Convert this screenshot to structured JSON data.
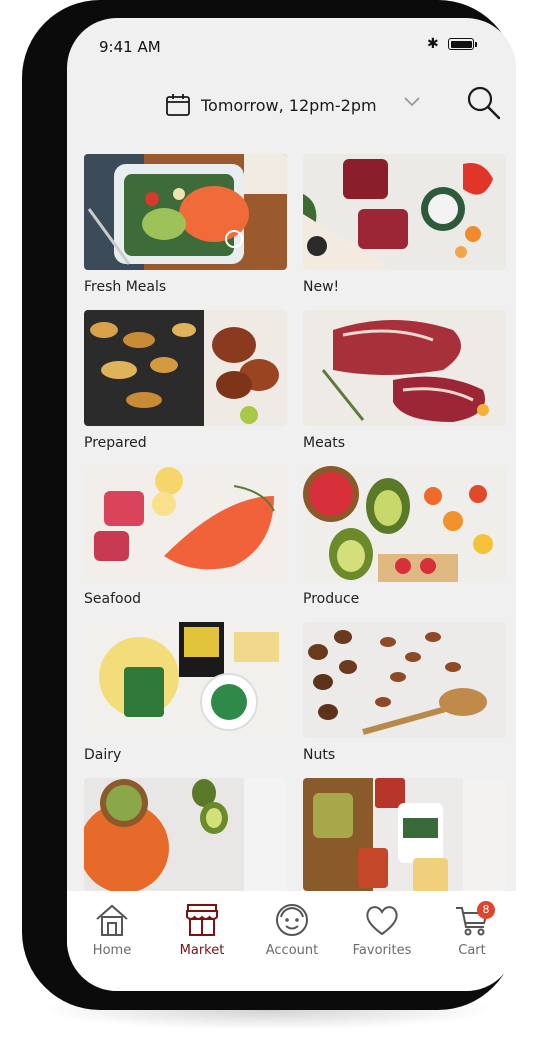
{
  "status_bar": {
    "time": "9:41 AM",
    "bluetooth": "✱"
  },
  "header": {
    "calendar_icon": "calendar-icon",
    "delivery_window": "Tomorrow, 12pm-2pm",
    "dropdown_icon": "chevron-down-icon",
    "search_icon": "search-icon"
  },
  "categories": [
    {
      "label": "Fresh Meals"
    },
    {
      "label": "New!"
    },
    {
      "label": "Prepared"
    },
    {
      "label": "Meats"
    },
    {
      "label": "Seafood"
    },
    {
      "label": "Produce"
    },
    {
      "label": "Dairy"
    },
    {
      "label": "Nuts"
    },
    {
      "label": ""
    },
    {
      "label": ""
    }
  ],
  "tabbar": {
    "tabs": [
      {
        "label": "Home",
        "icon": "home-icon",
        "active": false
      },
      {
        "label": "Market",
        "icon": "market-icon",
        "active": true
      },
      {
        "label": "Account",
        "icon": "account-icon",
        "active": false
      },
      {
        "label": "Favorites",
        "icon": "heart-icon",
        "active": false
      },
      {
        "label": "Cart",
        "icon": "cart-icon",
        "active": false
      }
    ],
    "cart_count": "8"
  },
  "colors": {
    "accent": "#7a1212",
    "badge": "#e0442c",
    "screen_bg": "#f1f0f1"
  }
}
